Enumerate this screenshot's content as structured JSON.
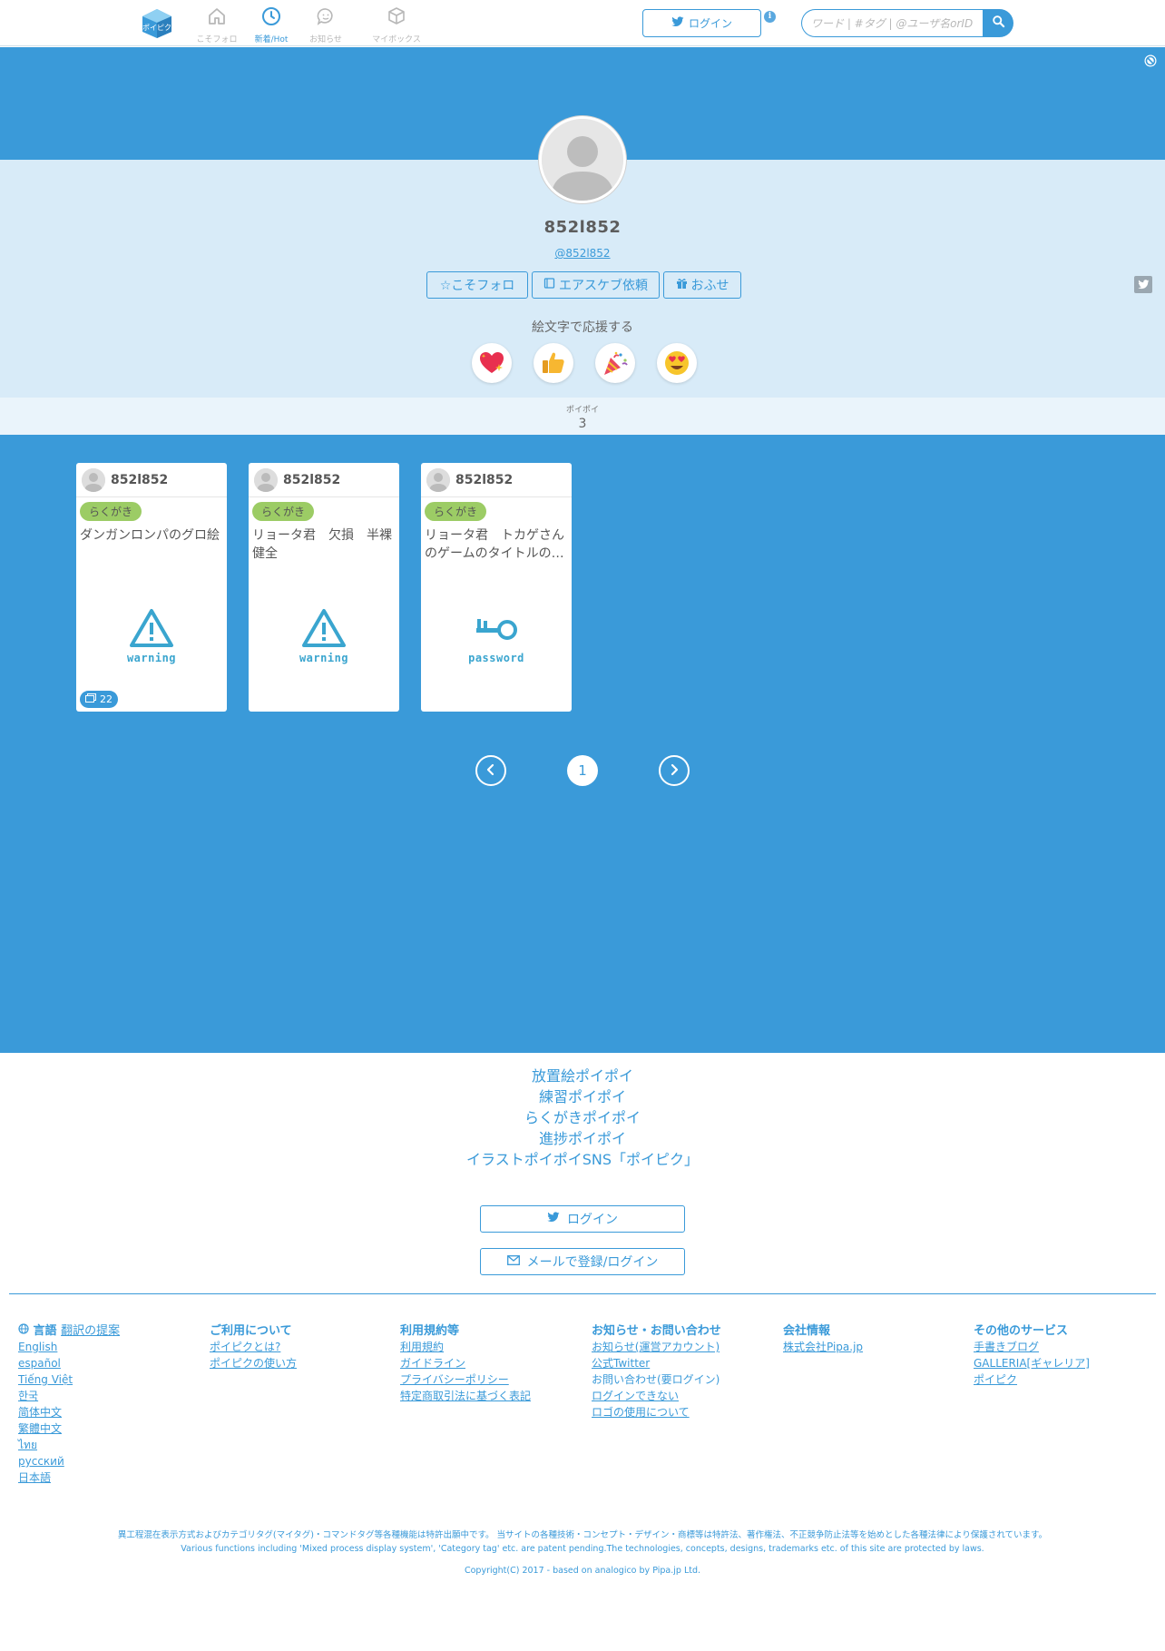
{
  "header": {
    "nav": [
      {
        "label": "こそフォロ",
        "icon": "home-icon"
      },
      {
        "label": "新着/Hot",
        "icon": "clock-icon",
        "active": true
      },
      {
        "label": "お知らせ",
        "icon": "chat-bubble-icon"
      },
      {
        "label": "マイボックス",
        "icon": "box-icon"
      }
    ],
    "login_label": "ログイン",
    "search_placeholder": "ワード | #タグ | @ユーザ名orID"
  },
  "profile": {
    "name": "852l852",
    "handle": "@852l852",
    "buttons": {
      "follow": "☆こそフォロ",
      "request": "エアスケブ依頼",
      "gift": "おふせ"
    },
    "emoji_title": "絵文字で応援する",
    "emojis": [
      "heart-sparkle-icon",
      "thumbs-up-icon",
      "party-popper-icon",
      "heart-eyes-icon"
    ],
    "stats_label": "ポイポイ",
    "stats_value": "3"
  },
  "cards": [
    {
      "user": "852l852",
      "tag": "らくがき",
      "text": "ダンガンロンパのグロ絵",
      "thumb": "warning",
      "thumb_icon": "warning-icon",
      "count": "22"
    },
    {
      "user": "852l852",
      "tag": "らくがき",
      "text": "リョータ君　欠損　半裸　健全",
      "thumb": "warning",
      "thumb_icon": "warning-icon"
    },
    {
      "user": "852l852",
      "tag": "らくがき",
      "text": "リョータ君　トカゲさんのゲームのタイトルの…",
      "thumb": "password",
      "thumb_icon": "key-icon"
    }
  ],
  "pager": {
    "current": "1"
  },
  "footer": {
    "links": [
      "放置絵ポイポイ",
      "練習ポイポイ",
      "らくがきポイポイ",
      "進捗ポイポイ",
      "イラストポイポイSNS「ポイピク」"
    ],
    "login_label": "ログイン",
    "email_label": "メールで登録/ログイン",
    "columns": {
      "lang": {
        "title": "言語",
        "suggest": "翻訳の提案",
        "items": [
          "English",
          "español",
          "Tiếng Việt",
          "한국",
          "简体中文",
          "繁體中文",
          "ไทย",
          "русский",
          "日本語"
        ]
      },
      "usage": {
        "title": "ご利用について",
        "items": [
          "ポイピクとは?",
          "ポイピクの使い方"
        ]
      },
      "terms": {
        "title": "利用規約等",
        "items": [
          "利用規約",
          "ガイドライン",
          "プライバシーポリシー",
          "特定商取引法に基づく表記"
        ]
      },
      "news": {
        "title": "お知らせ・お問い合わせ",
        "items": [
          "お知らせ(運営アカウント)",
          "公式Twitter",
          "お問い合わせ(要ログイン)",
          "ログインできない",
          "ロゴの使用について"
        ]
      },
      "company": {
        "title": "会社情報",
        "items": [
          "株式会社Pipa.jp"
        ]
      },
      "other": {
        "title": "その他のサービス",
        "items": [
          "手書きブログ",
          "GALLERIA[ギャレリア]",
          "ポイピク"
        ]
      }
    },
    "legal_jp": "異工程混在表示方式およびカテゴリタグ(マイタグ)・コマンドタグ等各種機能は特許出願中です。 当サイトの各種技術・コンセプト・デザイン・商標等は特許法、著作権法、不正競争防止法等を始めとした各種法律により保護されています。",
    "legal_en": "Various functions including 'Mixed process display system', 'Category tag' etc. are patent pending.The technologies, concepts, designs, trademarks etc. of this site are protected by laws.",
    "copyright_prefix": "Copyright(C) 2017 - based on",
    "copyright_link1": "analogico",
    "copyright_by": "by",
    "copyright_link2": "Pipa.jp Ltd."
  },
  "colors": {
    "accent": "#3a9ad9",
    "tag": "#9ccc65",
    "profile_bg": "#d8ebf8"
  }
}
